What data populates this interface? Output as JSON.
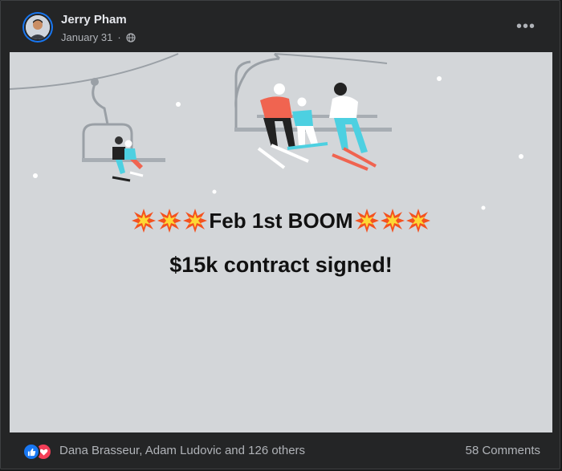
{
  "post": {
    "author": "Jerry Pham",
    "date": "January 31",
    "audience_icon": "globe-icon",
    "more_icon": "more-options-icon",
    "more_label": "•••"
  },
  "image": {
    "headline": "Feb 1st BOOM",
    "subline": "$15k contract signed!",
    "emoji": "collision-emoji"
  },
  "footer": {
    "reactions_text": "Dana Brasseur, Adam Ludovic and 126 others",
    "comments_text": "58 Comments",
    "reaction_icons": [
      "like-icon",
      "love-icon"
    ]
  },
  "colors": {
    "card_bg": "#242526",
    "text_primary": "#e4e6eb",
    "text_secondary": "#b0b3b8",
    "image_bg": "#d3d6d9",
    "like_blue": "#1877f2",
    "love_red": "#f33e58"
  }
}
